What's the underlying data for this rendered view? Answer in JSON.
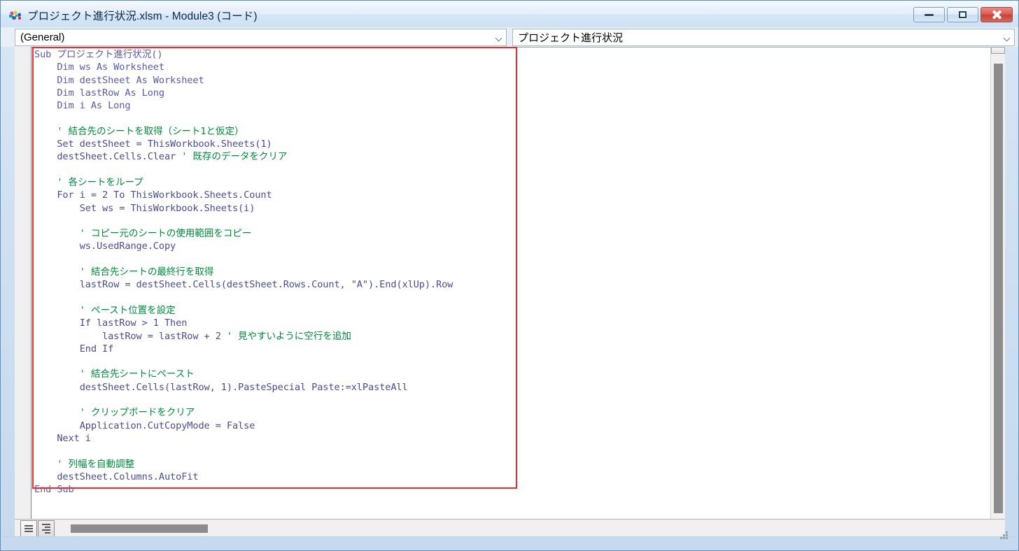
{
  "window": {
    "title": "プロジェクト進行状況.xlsm - Module3 (コード)",
    "icon": "vba-module-icon",
    "controls": {
      "minimize_label": "最小化",
      "minimize_icon": "minimize-icon",
      "restore_label": "元に戻す",
      "restore_icon": "restore-icon",
      "close_label": "閉じる",
      "close_icon": "close-icon"
    }
  },
  "toolbars": {
    "object_combo": {
      "name": "object-dropdown",
      "value": "(General)",
      "arrow_icon": "chevron-down-icon"
    },
    "procedure_combo": {
      "name": "procedure-dropdown",
      "value": "プロジェクト進行状況",
      "arrow_icon": "chevron-down-icon"
    }
  },
  "annotation": {
    "highlight_color": "#f02b2b",
    "shape": "rectangle"
  },
  "editor": {
    "colors": {
      "code": "#4b4b96",
      "keyword": "#5a5ab0",
      "comment": "#008b3d",
      "background": "#ffffff",
      "margin_bar": "#f0f0f0"
    },
    "lines": [
      {
        "indent": 0,
        "segments": [
          {
            "t": "Sub プロジェクト進行状況()",
            "c": "kw"
          }
        ]
      },
      {
        "indent": 4,
        "segments": [
          {
            "t": "Dim ws As Worksheet",
            "c": "kw"
          }
        ]
      },
      {
        "indent": 4,
        "segments": [
          {
            "t": "Dim destSheet As Worksheet",
            "c": "kw"
          }
        ]
      },
      {
        "indent": 4,
        "segments": [
          {
            "t": "Dim lastRow As Long",
            "c": "kw"
          }
        ]
      },
      {
        "indent": 4,
        "segments": [
          {
            "t": "Dim i As Long",
            "c": "kw"
          }
        ]
      },
      {
        "indent": 0,
        "segments": []
      },
      {
        "indent": 4,
        "segments": [
          {
            "t": "' 結合先のシートを取得（シート1と仮定）",
            "c": "cm"
          }
        ]
      },
      {
        "indent": 4,
        "segments": [
          {
            "t": "Set destSheet = ThisWorkbook.Sheets(1)",
            "c": "cd"
          }
        ]
      },
      {
        "indent": 4,
        "segments": [
          {
            "t": "destSheet.Cells.Clear ",
            "c": "cd"
          },
          {
            "t": "' 既存のデータをクリア",
            "c": "cm"
          }
        ]
      },
      {
        "indent": 0,
        "segments": []
      },
      {
        "indent": 4,
        "segments": [
          {
            "t": "' 各シートをループ",
            "c": "cm"
          }
        ]
      },
      {
        "indent": 4,
        "segments": [
          {
            "t": "For i = 2 To ThisWorkbook.Sheets.Count",
            "c": "cd"
          }
        ]
      },
      {
        "indent": 8,
        "segments": [
          {
            "t": "Set ws = ThisWorkbook.Sheets(i)",
            "c": "cd"
          }
        ]
      },
      {
        "indent": 0,
        "segments": []
      },
      {
        "indent": 8,
        "segments": [
          {
            "t": "' コピー元のシートの使用範囲をコピー",
            "c": "cm"
          }
        ]
      },
      {
        "indent": 8,
        "segments": [
          {
            "t": "ws.UsedRange.Copy",
            "c": "cd"
          }
        ]
      },
      {
        "indent": 0,
        "segments": []
      },
      {
        "indent": 8,
        "segments": [
          {
            "t": "' 結合先シートの最終行を取得",
            "c": "cm"
          }
        ]
      },
      {
        "indent": 8,
        "segments": [
          {
            "t": "lastRow = destSheet.Cells(destSheet.Rows.Count, \"A\").End(xlUp).Row",
            "c": "cd"
          }
        ]
      },
      {
        "indent": 0,
        "segments": []
      },
      {
        "indent": 8,
        "segments": [
          {
            "t": "' ペースト位置を設定",
            "c": "cm"
          }
        ]
      },
      {
        "indent": 8,
        "segments": [
          {
            "t": "If lastRow > 1 Then",
            "c": "cd"
          }
        ]
      },
      {
        "indent": 12,
        "segments": [
          {
            "t": "lastRow = lastRow + 2 ",
            "c": "cd"
          },
          {
            "t": "' 見やすいように空行を追加",
            "c": "cm"
          }
        ]
      },
      {
        "indent": 8,
        "segments": [
          {
            "t": "End If",
            "c": "cd"
          }
        ]
      },
      {
        "indent": 0,
        "segments": []
      },
      {
        "indent": 8,
        "segments": [
          {
            "t": "' 結合先シートにペースト",
            "c": "cm"
          }
        ]
      },
      {
        "indent": 8,
        "segments": [
          {
            "t": "destSheet.Cells(lastRow, 1).PasteSpecial Paste:=xlPasteAll",
            "c": "cd"
          }
        ]
      },
      {
        "indent": 0,
        "segments": []
      },
      {
        "indent": 8,
        "segments": [
          {
            "t": "' クリップボードをクリア",
            "c": "cm"
          }
        ]
      },
      {
        "indent": 8,
        "segments": [
          {
            "t": "Application.CutCopyMode = False",
            "c": "cd"
          }
        ]
      },
      {
        "indent": 4,
        "segments": [
          {
            "t": "Next i",
            "c": "cd"
          }
        ]
      },
      {
        "indent": 0,
        "segments": []
      },
      {
        "indent": 4,
        "segments": [
          {
            "t": "' 列幅を自動調整",
            "c": "cm"
          }
        ]
      },
      {
        "indent": 4,
        "segments": [
          {
            "t": "destSheet.Columns.AutoFit",
            "c": "cd"
          }
        ]
      },
      {
        "indent": 0,
        "segments": [
          {
            "t": "End Sub",
            "c": "kw"
          }
        ]
      }
    ]
  },
  "status_bar": {
    "procedure_view_button": {
      "name": "procedure-view-button",
      "icon": "procedure-view-icon"
    },
    "full_module_view_button": {
      "name": "full-module-view-button",
      "icon": "full-module-view-icon"
    },
    "horizontal_scrollbar": "h-scrollbar",
    "resize_grip": "resize-grip-icon"
  },
  "scrollbars": {
    "vertical": {
      "name": "v-scrollbar",
      "up_arrow_icon": "scroll-up-icon"
    }
  }
}
